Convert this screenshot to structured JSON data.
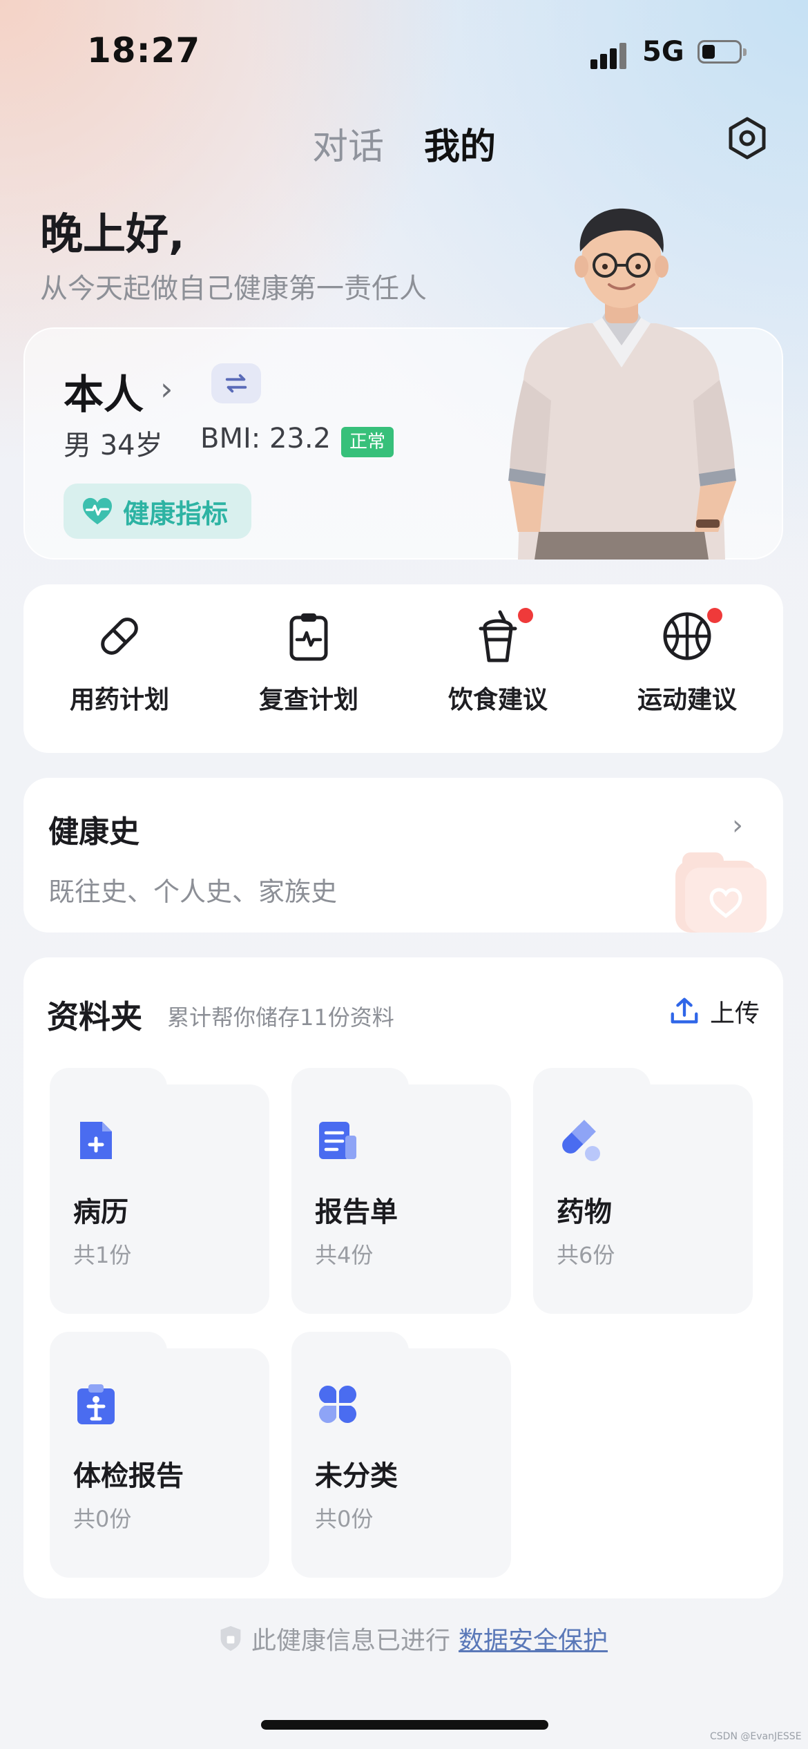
{
  "status_bar": {
    "time": "18:27",
    "network": "5G"
  },
  "tabs": {
    "chat": "对话",
    "mine": "我的"
  },
  "greeting": {
    "title": "晚上好,",
    "slogan": "从今天起做自己健康第一责任人"
  },
  "profile": {
    "name": "本人",
    "gender_age": "男 34岁",
    "bmi": "BMI: 23.2",
    "status": "正常",
    "health_button": "健康指标"
  },
  "quick_actions": [
    {
      "label": "用药计划",
      "icon": "pill-icon",
      "badge": false
    },
    {
      "label": "复查计划",
      "icon": "clipboard-pulse-icon",
      "badge": false
    },
    {
      "label": "饮食建议",
      "icon": "drink-cup-icon",
      "badge": true
    },
    {
      "label": "运动建议",
      "icon": "basketball-icon",
      "badge": true
    }
  ],
  "health_history": {
    "title": "健康史",
    "subtitle": "既往史、个人史、家族史"
  },
  "folder": {
    "title": "资料夹",
    "subtitle": "累计帮你储存11份资料",
    "upload_label": "上传",
    "items": [
      {
        "name": "病历",
        "count": "共1份",
        "icon": "medical-record-icon"
      },
      {
        "name": "报告单",
        "count": "共4份",
        "icon": "report-icon"
      },
      {
        "name": "药物",
        "count": "共6份",
        "icon": "medicine-icon"
      },
      {
        "name": "体检报告",
        "count": "共0份",
        "icon": "checkup-report-icon"
      },
      {
        "name": "未分类",
        "count": "共0份",
        "icon": "uncategorized-icon"
      }
    ]
  },
  "footer": {
    "note": "此健康信息已进行",
    "link": "数据安全保护"
  },
  "watermark": "CSDN @EvanJESSE",
  "colors": {
    "accent_blue": "#4a6cf0",
    "badge_red": "#ef3a3a",
    "status_green": "#37c07a",
    "teal": "#2db3a3"
  }
}
